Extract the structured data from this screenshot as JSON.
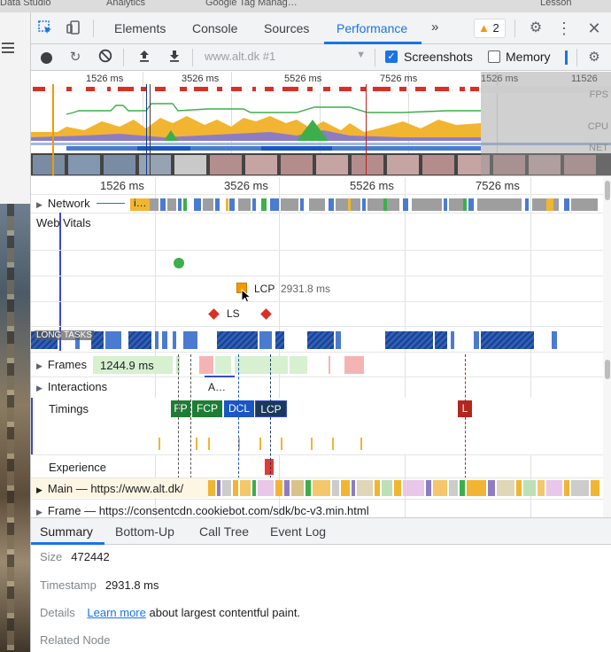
{
  "background": {
    "top_strip": [
      "Data Studio",
      "Analytics",
      "Google Tag Manag…",
      "Lesson"
    ]
  },
  "tabs": {
    "items": [
      "Elements",
      "Console",
      "Sources",
      "Performance"
    ],
    "active": "Performance",
    "overflow": "»",
    "warnings_count": "2",
    "accent": "#1a73e8"
  },
  "toolbar": {
    "profile": "www.alt.dk #1",
    "screenshots_label": "Screenshots",
    "memory_label": "Memory"
  },
  "overview": {
    "times": [
      "1526 ms",
      "3526 ms",
      "5526 ms",
      "7526 ms",
      "1526 ms",
      "11526 ms"
    ],
    "lanes": [
      "FPS",
      "CPU",
      "NET"
    ]
  },
  "ruler": {
    "times": [
      "1526 ms",
      "3526 ms",
      "5526 ms",
      "7526 ms"
    ]
  },
  "tracks": {
    "network": "Network",
    "network_chip": "i…",
    "web_vitals": "Web Vitals",
    "lcp_label": "LCP",
    "lcp_value": "2931.8 ms",
    "ls_label": "LS",
    "long_tasks": "LONG TASKS",
    "frames": "Frames",
    "frames_value": "1244.9 ms",
    "interactions": "Interactions",
    "interactions_chip": "A…",
    "timings": "Timings",
    "timing_pills": [
      {
        "label": "FP",
        "color": "#1e7d34"
      },
      {
        "label": "FCP",
        "color": "#1e7d34"
      },
      {
        "label": "DCL",
        "color": "#1a56c4"
      },
      {
        "label": "LCP",
        "color": "#1a3a5c"
      }
    ],
    "load_pill": "L",
    "experience": "Experience",
    "main": "Main — https://www.alt.dk/",
    "frame": "Frame — https://consentcdn.cookiebot.com/sdk/bc-v3.min.html"
  },
  "bottom": {
    "tabs": [
      "Summary",
      "Bottom-Up",
      "Call Tree",
      "Event Log"
    ],
    "active": "Summary",
    "size_key": "Size",
    "size_value": "472442",
    "timestamp_key": "Timestamp",
    "timestamp_value": "2931.8 ms",
    "details_key": "Details",
    "details_link": "Learn more",
    "details_text": "about largest contentful paint.",
    "related_node_key": "Related Node"
  }
}
